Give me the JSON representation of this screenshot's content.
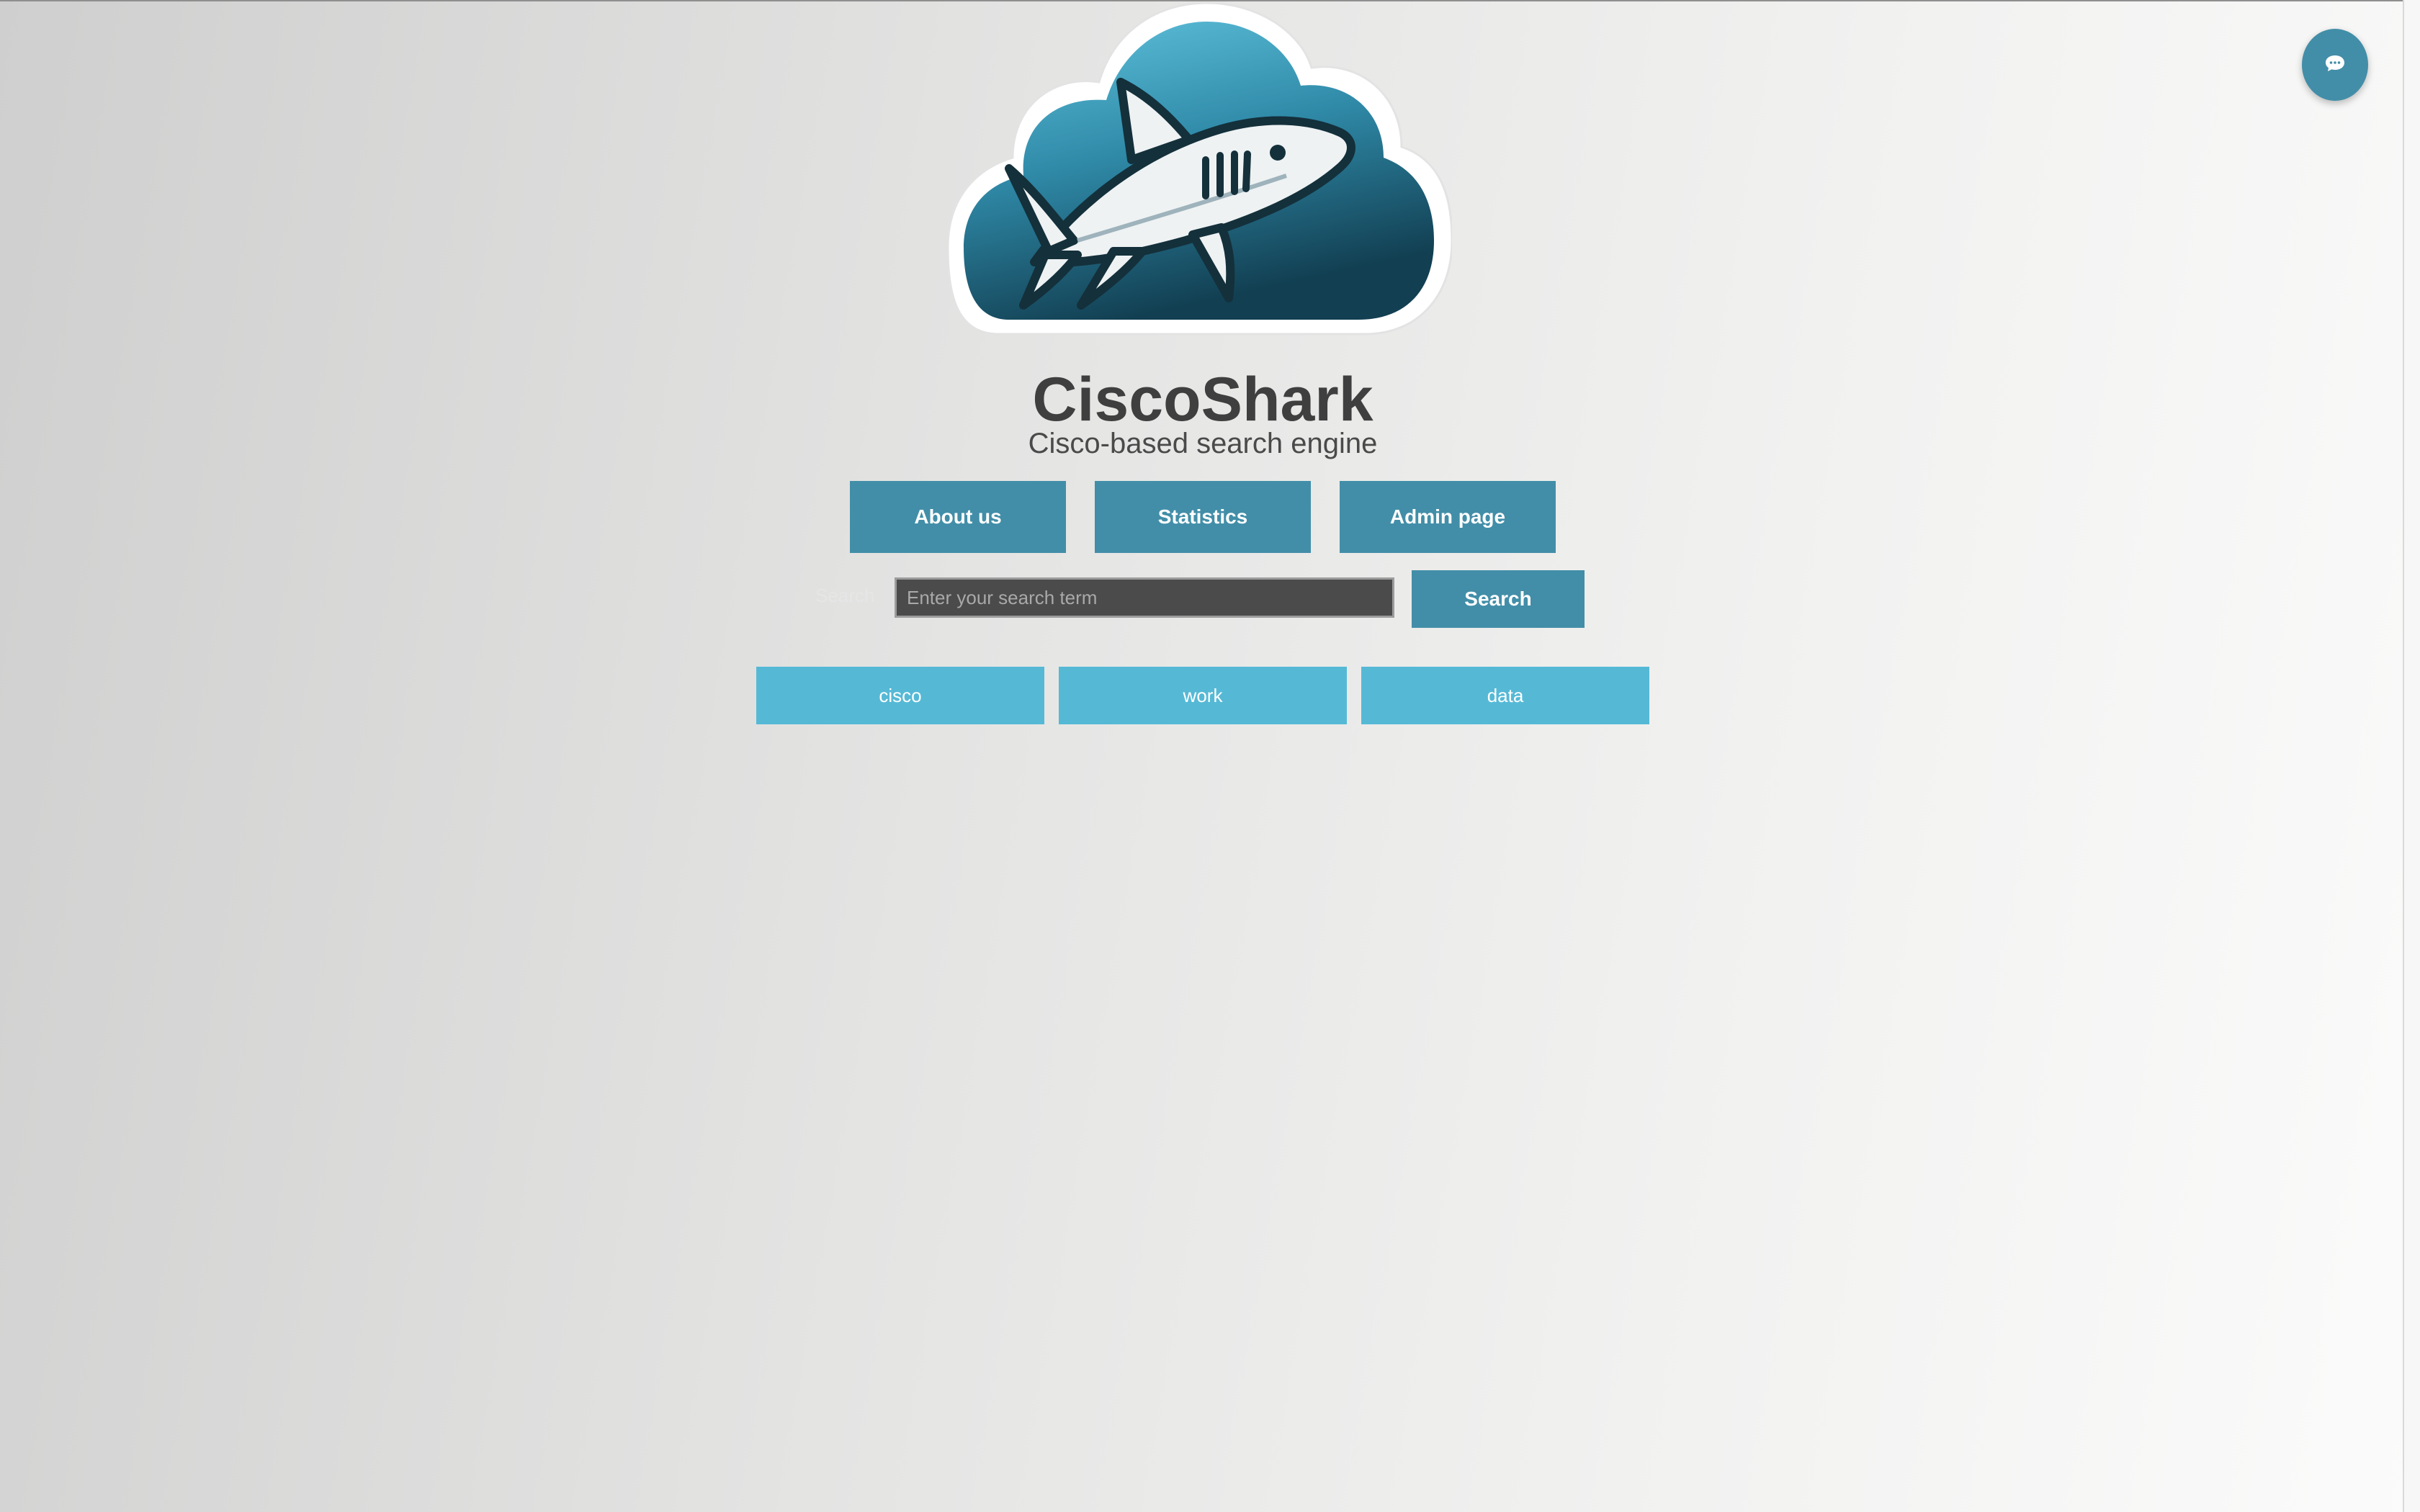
{
  "app": {
    "title": "CiscoShark",
    "subtitle": "Cisco-based search engine"
  },
  "nav": {
    "items": [
      {
        "label": "About us"
      },
      {
        "label": "Statistics"
      },
      {
        "label": "Admin page"
      }
    ]
  },
  "search": {
    "label": "Search",
    "placeholder": "Enter your search term",
    "value": "",
    "button_label": "Search"
  },
  "tags": [
    {
      "label": "cisco"
    },
    {
      "label": "work"
    },
    {
      "label": "data"
    }
  ],
  "chat": {
    "icon": "chat-bubble-icon"
  },
  "colors": {
    "primary": "#428ea8",
    "tag": "#55b9d6",
    "logo_cloud_dark": "#16485a",
    "logo_cloud_light": "#5fc4de",
    "title_text": "#3f3f3f"
  }
}
